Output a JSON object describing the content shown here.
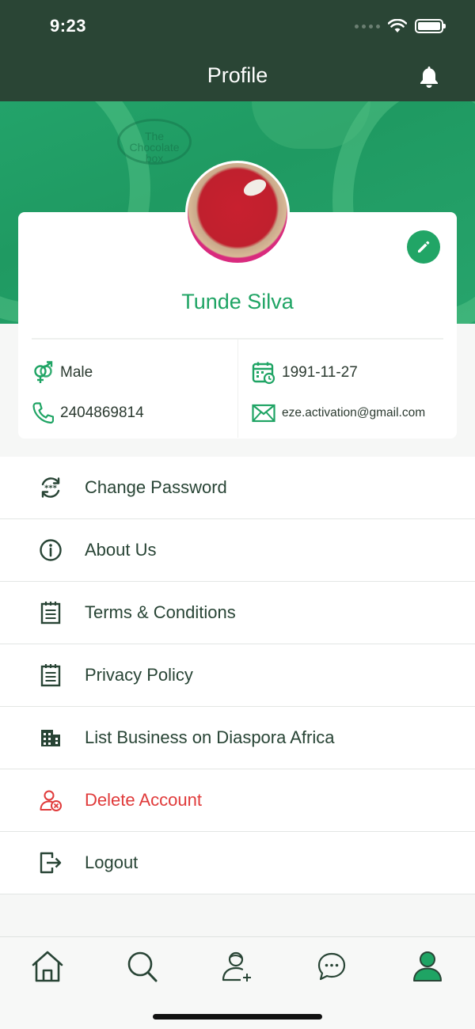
{
  "status_bar": {
    "time": "9:23"
  },
  "nav": {
    "title": "Profile",
    "bell_icon": "bell-icon"
  },
  "cover": {
    "logo_text": "The Chocolate box"
  },
  "profile": {
    "name": "Tunde Silva",
    "gender": "Male",
    "birthdate": "1991-11-27",
    "phone": "2404869814",
    "email": "eze.activation@gmail.com"
  },
  "menu": {
    "items": [
      {
        "label": "Change Password",
        "icon": "password-refresh-icon",
        "color": "#284435"
      },
      {
        "label": "About Us",
        "icon": "info-icon",
        "color": "#284435"
      },
      {
        "label": "Terms & Conditions",
        "icon": "notepad-icon",
        "color": "#284435"
      },
      {
        "label": "Privacy Policy",
        "icon": "notepad-icon",
        "color": "#284435"
      },
      {
        "label": "List Business on Diaspora Africa",
        "icon": "building-icon",
        "color": "#284435"
      },
      {
        "label": "Delete Account",
        "icon": "user-remove-icon",
        "color": "#e03a3a"
      },
      {
        "label": "Logout",
        "icon": "logout-icon",
        "color": "#284435"
      }
    ]
  },
  "tab_bar": {
    "tabs": [
      {
        "name": "home",
        "icon": "home-icon"
      },
      {
        "name": "search",
        "icon": "search-icon"
      },
      {
        "name": "add-friend",
        "icon": "user-add-icon"
      },
      {
        "name": "messages",
        "icon": "chat-icon"
      },
      {
        "name": "profile",
        "icon": "profile-icon",
        "active": true
      }
    ]
  },
  "colors": {
    "header": "#2a4535",
    "accent": "#1fa464",
    "danger": "#e03a3a",
    "text": "#284435"
  }
}
